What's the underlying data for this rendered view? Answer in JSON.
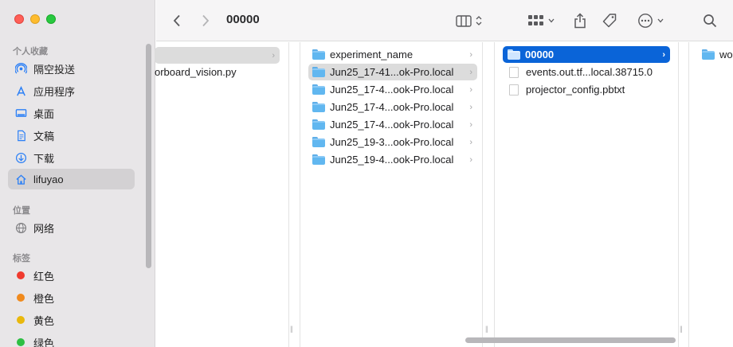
{
  "sidebar": {
    "favorites_header": "个人收藏",
    "favorites": [
      {
        "label": "隔空投送",
        "icon": "airdrop-icon"
      },
      {
        "label": "应用程序",
        "icon": "applications-icon"
      },
      {
        "label": "桌面",
        "icon": "desktop-icon"
      },
      {
        "label": "文稿",
        "icon": "documents-icon"
      },
      {
        "label": "下载",
        "icon": "downloads-icon"
      },
      {
        "label": "lifuyao",
        "icon": "home-icon",
        "active": true
      }
    ],
    "locations_header": "位置",
    "locations": [
      {
        "label": "网络",
        "icon": "network-icon"
      }
    ],
    "tags_header": "标签",
    "tags": [
      {
        "label": "红色",
        "color": "#f03a2e"
      },
      {
        "label": "橙色",
        "color": "#f08a1d"
      },
      {
        "label": "黄色",
        "color": "#e9b80c"
      },
      {
        "label": "绿色",
        "color": "#2ebf43"
      }
    ]
  },
  "toolbar": {
    "title": "00000",
    "back_icon": "chevron-left-icon",
    "forward_icon": "chevron-right-icon",
    "view_icon": "column-view-icon",
    "group_icon": "grid-group-icon",
    "share_icon": "share-icon",
    "tag_icon": "tag-icon",
    "more_icon": "ellipsis-circle-icon",
    "search_icon": "search-icon"
  },
  "columns": {
    "col1": [
      {
        "label": "orboard_vision.py",
        "type": "file"
      }
    ],
    "col2": [
      {
        "label": "experiment_name",
        "type": "folder"
      },
      {
        "label": "Jun25_17-41...ok-Pro.local",
        "type": "folder",
        "state": "highlight"
      },
      {
        "label": "Jun25_17-4...ook-Pro.local",
        "type": "folder"
      },
      {
        "label": "Jun25_17-4...ook-Pro.local",
        "type": "folder"
      },
      {
        "label": "Jun25_17-4...ook-Pro.local",
        "type": "folder"
      },
      {
        "label": "Jun25_19-3...ook-Pro.local",
        "type": "folder"
      },
      {
        "label": "Jun25_19-4...ook-Pro.local",
        "type": "folder"
      }
    ],
    "col3": [
      {
        "label": "00000",
        "type": "folder",
        "state": "selected"
      },
      {
        "label": "events.out.tf...local.38715.0",
        "type": "file"
      },
      {
        "label": "projector_config.pbtxt",
        "type": "file"
      }
    ],
    "col4": [
      {
        "label": "wo",
        "type": "folder"
      }
    ]
  },
  "colors": {
    "selection": "#0a64d8",
    "folder": "#61b7f0",
    "sidebar_bg": "#e8e6e8"
  }
}
